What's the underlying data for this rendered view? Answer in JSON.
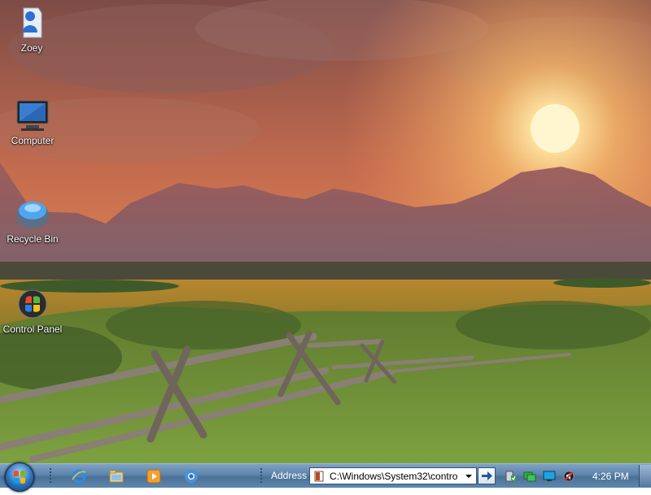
{
  "desktop": {
    "icons": [
      {
        "label": "Zoey",
        "icon": "user-folder-icon"
      },
      {
        "label": "Computer",
        "icon": "computer-icon"
      },
      {
        "label": "Recycle Bin",
        "icon": "recycle-bin-icon"
      },
      {
        "label": "Control Panel",
        "icon": "control-panel-icon"
      }
    ],
    "wallpaper": "sunset-over-mountains-with-fence"
  },
  "taskbar": {
    "start_icon": "start-orb-icon",
    "quick_launch": [
      {
        "icon": "internet-explorer-icon"
      },
      {
        "icon": "windows-explorer-icon"
      },
      {
        "icon": "media-player-icon"
      },
      {
        "icon": "chrome-icon"
      }
    ],
    "address": {
      "label": "Address",
      "value": "C:\\Windows\\System32\\contro"
    },
    "tray_icons": [
      {
        "icon": "security-shield-icon"
      },
      {
        "icon": "network-icon"
      },
      {
        "icon": "display-icon"
      },
      {
        "icon": "volume-icon"
      }
    ],
    "clock": "4:26 PM"
  },
  "colors": {
    "taskbar_top": "#7fa2c4",
    "taskbar_bottom": "#4b7198",
    "sky_top": "#7d5147",
    "sun": "#fff4c8"
  }
}
